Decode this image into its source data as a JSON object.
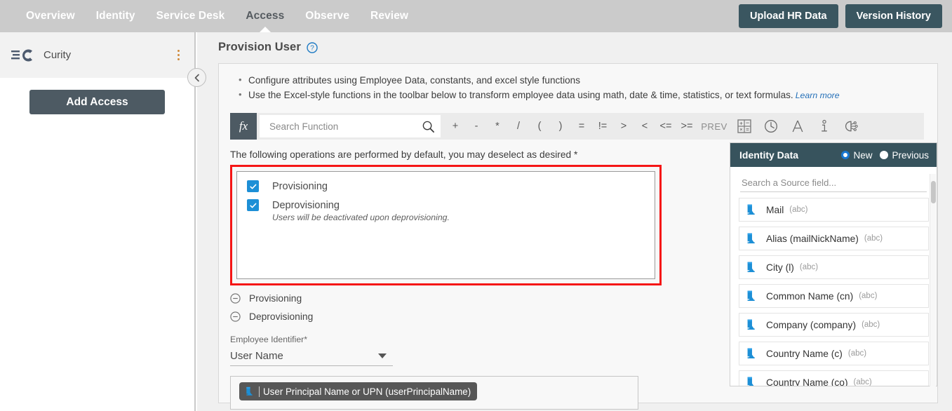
{
  "topnav": {
    "items": [
      {
        "label": "Overview",
        "active": false
      },
      {
        "label": "Identity",
        "active": false
      },
      {
        "label": "Service Desk",
        "active": false
      },
      {
        "label": "Access",
        "active": true
      },
      {
        "label": "Observe",
        "active": false
      },
      {
        "label": "Review",
        "active": false
      }
    ],
    "upload_button": "Upload HR Data",
    "version_button": "Version History",
    "bg_color": "#cbcbcb",
    "button_color": "#3a5660"
  },
  "sidebar": {
    "app_name": "Curity",
    "menu_icon": "kebab-menu-icon",
    "add_access_button": "Add Access",
    "collapse_icon": "chevron-left-icon"
  },
  "main": {
    "page_title": "Provision User",
    "help_icon": "help-circle-icon",
    "bullets": [
      {
        "text": "Configure attributes using Employee Data, constants, and excel style functions",
        "link": ""
      },
      {
        "text": "Use the Excel-style functions in the toolbar below to transform employee data using math, date & time, statistics, or text formulas.",
        "link": "Learn more"
      }
    ],
    "toolbar": {
      "fx_label": "fx",
      "search_placeholder": "Search Function",
      "search_value": "",
      "search_icon": "magnifier-icon",
      "operators": [
        "+",
        "-",
        "*",
        "/",
        "(",
        ")",
        "=",
        "!=",
        ">",
        "<",
        "<=",
        ">="
      ],
      "prev_label": "PREV",
      "icons": [
        {
          "name": "calculator-icon",
          "title": "Math"
        },
        {
          "name": "clock-icon",
          "title": "Date & Time"
        },
        {
          "name": "letter-a-icon",
          "title": "Text"
        },
        {
          "name": "info-icon",
          "title": "Statistics"
        },
        {
          "name": "brain-icon",
          "title": "Smart"
        }
      ]
    },
    "operations_label": "The following operations are performed by default, you may deselect as desired *",
    "operations": [
      {
        "label": "Provisioning",
        "checked": true
      },
      {
        "label": "Deprovisioning",
        "checked": true
      }
    ],
    "operations_hint": "Users will be deactivated upon deprovisioning.",
    "highlight_color": "#f51616",
    "checkbox_color": "#1d8fd6",
    "collapsibles": [
      {
        "label": "Provisioning",
        "icon": "minus-circle-icon"
      },
      {
        "label": "Deprovisioning",
        "icon": "minus-circle-icon"
      }
    ],
    "employee_identifier": {
      "label": "Employee Identifier*",
      "value": "User Name",
      "caret_icon": "chevron-down-icon"
    },
    "formula": {
      "chip_icon": "source-field-icon",
      "chip_label": "User Principal Name or UPN (userPrincipalName)"
    }
  },
  "identity_panel": {
    "title": "Identity Data",
    "header_color": "#37535d",
    "radios": [
      {
        "label": "New",
        "selected": true
      },
      {
        "label": "Previous",
        "selected": false
      }
    ],
    "search_placeholder": "Search a Source field...",
    "search_value": "",
    "fields": [
      {
        "name": "Mail",
        "type": "(abc)",
        "icon": "source-field-icon"
      },
      {
        "name": "Alias (mailNickName)",
        "type": "(abc)",
        "icon": "source-field-icon"
      },
      {
        "name": "City (l)",
        "type": "(abc)",
        "icon": "source-field-icon"
      },
      {
        "name": "Common Name (cn)",
        "type": "(abc)",
        "icon": "source-field-icon"
      },
      {
        "name": "Company (company)",
        "type": "(abc)",
        "icon": "source-field-icon"
      },
      {
        "name": "Country Name (c)",
        "type": "(abc)",
        "icon": "source-field-icon"
      },
      {
        "name": "Country Name (co)",
        "type": "(abc)",
        "icon": "source-field-icon"
      }
    ]
  }
}
